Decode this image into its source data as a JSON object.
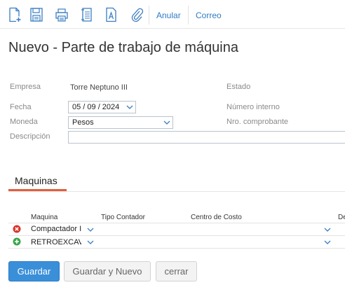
{
  "toolbar": {
    "icons": [
      "new-document-icon",
      "save-icon",
      "print-icon",
      "document-list-icon",
      "text-document-icon",
      "attach-icon"
    ],
    "anular_label": "Anular",
    "correo_label": "Correo"
  },
  "title": "Nuevo - Parte de trabajo de máquina",
  "form": {
    "empresa_label": "Empresa",
    "empresa_value": "Torre Neptuno III",
    "estado_label": "Estado",
    "fecha_label": "Fecha",
    "fecha_value": "05 / 09 /  2024",
    "numero_interno_label": "Número interno",
    "moneda_label": "Moneda",
    "moneda_value": "Pesos",
    "nro_comprobante_label": "Nro. comprobante",
    "descripcion_label": "Descripción",
    "descripcion_value": ""
  },
  "tab": {
    "label": "Maquinas"
  },
  "grid": {
    "headers": {
      "maquina": "Maquina",
      "tipo_contador": "Tipo Contador",
      "centro_costo": "Centro de Costo",
      "extra": "De"
    },
    "rows": [
      {
        "maquina": "Compactador I",
        "action": "delete-icon"
      },
      {
        "maquina": "RETROEXCAVADORA",
        "action": "add-icon"
      }
    ]
  },
  "buttons": {
    "guardar": "Guardar",
    "guardar_nuevo": "Guardar y Nuevo",
    "cerrar": "cerrar"
  },
  "colors": {
    "link": "#2f7bc4",
    "primary": "#3a8fd9",
    "tab_accent": "#e35d3c",
    "delete": "#d9342b",
    "add": "#3aa64a"
  }
}
